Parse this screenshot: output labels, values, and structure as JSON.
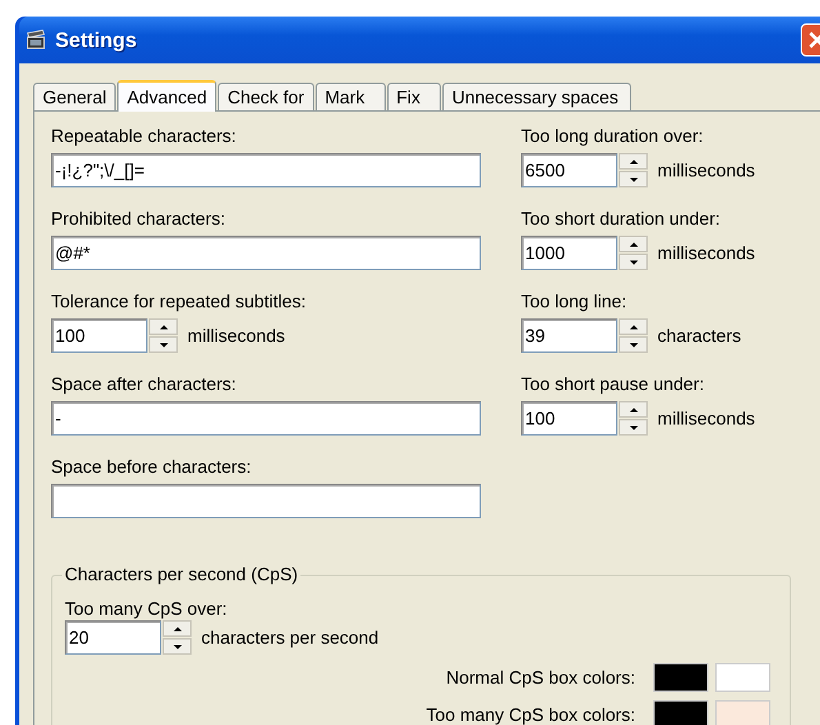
{
  "window": {
    "title": "Settings"
  },
  "tabs": [
    {
      "label": "General",
      "selected": false
    },
    {
      "label": "Advanced",
      "selected": true
    },
    {
      "label": "Check for",
      "selected": false
    },
    {
      "label": "Mark",
      "selected": false
    },
    {
      "label": "Fix",
      "selected": false
    },
    {
      "label": "Unnecessary spaces",
      "selected": false
    }
  ],
  "left_fields": [
    {
      "kind": "text",
      "label": "Repeatable characters:",
      "value": "-¡!¿?\";\\/_[]="
    },
    {
      "kind": "text",
      "label": "Prohibited characters:",
      "value": "@#*"
    },
    {
      "kind": "spin",
      "label": "Tolerance for repeated subtitles:",
      "value": "100",
      "unit": "milliseconds"
    },
    {
      "kind": "text",
      "label": "Space after characters:",
      "value": "-"
    },
    {
      "kind": "text",
      "label": "Space before characters:"
    }
  ],
  "right_fields": [
    {
      "kind": "spin",
      "label": "Too long duration over:",
      "value": "6500",
      "unit": "milliseconds"
    },
    {
      "kind": "spin",
      "label": "Too short duration under:",
      "value": "1000",
      "unit": "milliseconds"
    },
    {
      "kind": "spin",
      "label": "Too long line:",
      "value": "39",
      "unit": "characters"
    },
    {
      "kind": "spin",
      "label": "Too short pause under:",
      "value": "100",
      "unit": "milliseconds"
    }
  ],
  "cps_group": {
    "title": "Characters per second (CpS)",
    "field": {
      "label": "Too many CpS over:",
      "value": "20",
      "unit": "characters per second"
    },
    "color_rows": [
      {
        "label": "Normal CpS box colors:",
        "swatches": [
          {
            "color": "#000000"
          },
          {
            "color": "#ffffff"
          }
        ]
      },
      {
        "label": "Too many CpS box colors:",
        "swatches": [
          {
            "color": "#000000"
          },
          {
            "color": "#fbe9dc"
          }
        ]
      }
    ]
  }
}
